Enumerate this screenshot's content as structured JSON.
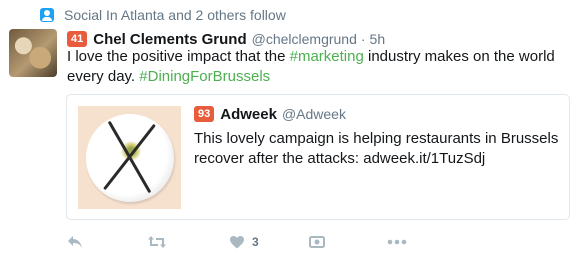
{
  "social_context": {
    "text": "Social In Atlanta and 2 others follow",
    "icon": "person-icon"
  },
  "tweet": {
    "score": "41",
    "author_name": "Chel Clements Grund",
    "handle": "@chelclemgrund",
    "dot": "·",
    "time": "5h",
    "text_part1": "I love the positive impact that the ",
    "hashtag1": "#marketing",
    "text_part2": " industry makes on the world every day. ",
    "hashtag2": "#DiningForBrussels"
  },
  "quoted": {
    "score": "93",
    "author_name": "Adweek",
    "handle": "@Adweek",
    "text": "This lovely campaign is helping restaurants in Brussels recover after the attacks: adweek.it/1TuzSdj"
  },
  "actions": {
    "reply_icon": "reply-icon",
    "retweet_icon": "retweet-icon",
    "like_icon": "heart-icon",
    "like_count": "3",
    "media_icon": "media-icon",
    "more_icon": "more-icon"
  },
  "colors": {
    "accent": "#1da1f2",
    "score_badge": "#e85c3d",
    "hashtag": "#4caf50",
    "muted": "#657786",
    "icon": "#aab8c2"
  }
}
